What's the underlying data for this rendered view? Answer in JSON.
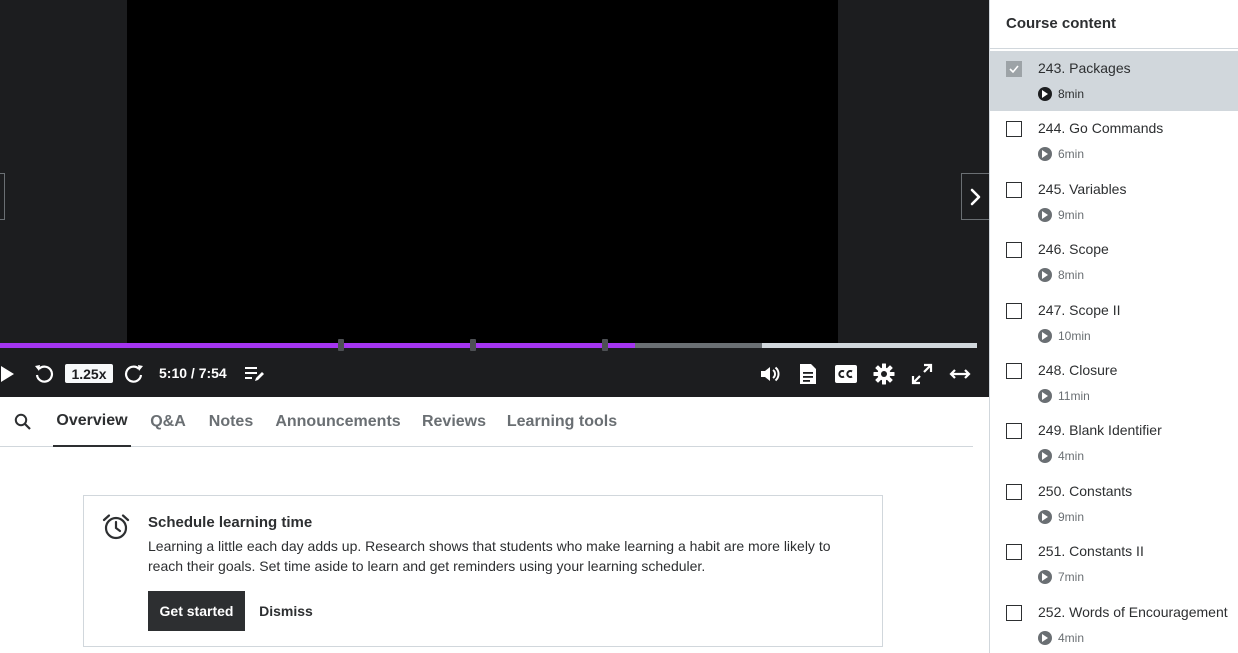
{
  "player": {
    "speed": "1.25x",
    "time": "5:10 / 7:54",
    "progress_played": 0.65,
    "progress_buffered": 0.78
  },
  "tabs": [
    {
      "label": "Overview",
      "active": true
    },
    {
      "label": "Q&A",
      "active": false
    },
    {
      "label": "Notes",
      "active": false
    },
    {
      "label": "Announcements",
      "active": false
    },
    {
      "label": "Reviews",
      "active": false
    },
    {
      "label": "Learning tools",
      "active": false
    }
  ],
  "schedule": {
    "title": "Schedule learning time",
    "description": "Learning a little each day adds up. Research shows that students who make learning a habit are more likely to reach their goals. Set time aside to learn and get reminders using your learning scheduler.",
    "primary_label": "Get started",
    "secondary_label": "Dismiss"
  },
  "sidebar": {
    "title": "Course content",
    "lectures": [
      {
        "title": "243. Packages",
        "duration": "8min",
        "completed": true,
        "current": true
      },
      {
        "title": "244. Go Commands",
        "duration": "6min",
        "completed": false,
        "current": false
      },
      {
        "title": "245. Variables",
        "duration": "9min",
        "completed": false,
        "current": false
      },
      {
        "title": "246. Scope",
        "duration": "8min",
        "completed": false,
        "current": false
      },
      {
        "title": "247. Scope II",
        "duration": "10min",
        "completed": false,
        "current": false
      },
      {
        "title": "248. Closure",
        "duration": "11min",
        "completed": false,
        "current": false
      },
      {
        "title": "249. Blank Identifier",
        "duration": "4min",
        "completed": false,
        "current": false
      },
      {
        "title": "250. Constants",
        "duration": "9min",
        "completed": false,
        "current": false
      },
      {
        "title": "251. Constants II",
        "duration": "7min",
        "completed": false,
        "current": false
      },
      {
        "title": "252. Words of Encouragement",
        "duration": "4min",
        "completed": false,
        "current": false
      }
    ]
  },
  "colors": {
    "accent": "#a435f0",
    "player_bg": "#1c1d1f",
    "text": "#2d2f31",
    "muted": "#6a6f73"
  }
}
